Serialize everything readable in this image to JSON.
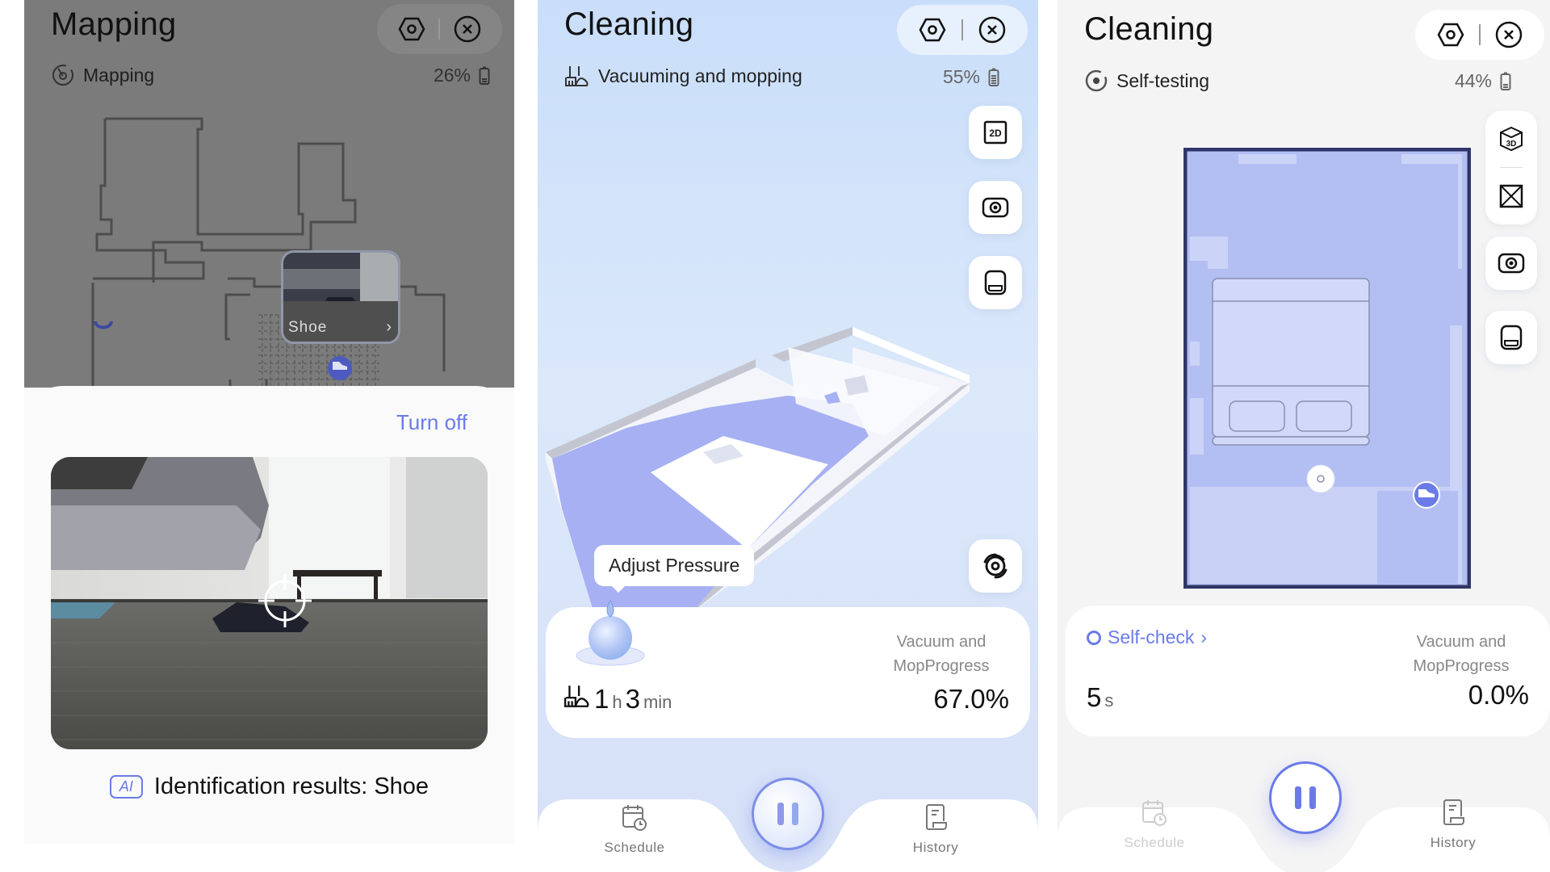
{
  "panels": [
    {
      "title": "Mapping",
      "status": {
        "icon": "mapping-icon",
        "text": "Mapping"
      },
      "battery": {
        "percent": "26%",
        "icon": "battery-icon"
      },
      "header_actions": [
        {
          "icon": "settings-hex-icon"
        },
        {
          "icon": "close-circle-icon"
        }
      ],
      "obstacle_thumbnail": {
        "label": "Shoe",
        "icon": "chevron-right-icon"
      },
      "map_markers": [
        {
          "icon": "shoe-marker-icon"
        },
        {
          "icon": "dock-icon"
        }
      ],
      "sheet": {
        "turn_off_label": "Turn off",
        "camera_view": {
          "description": "camera frame of shoe under sofa"
        },
        "ai_badge": "AI",
        "identification": "Identification results: Shoe"
      }
    },
    {
      "title": "Cleaning",
      "status": {
        "icon": "vacuum-mop-icon",
        "text": "Vacuuming and mopping"
      },
      "battery": {
        "percent": "55%",
        "icon": "battery-icon"
      },
      "header_actions": [
        {
          "icon": "settings-hex-icon"
        },
        {
          "icon": "close-circle-icon"
        }
      ],
      "side_buttons": [
        {
          "icon": "view-2d-icon",
          "label": "2D"
        },
        {
          "icon": "camera-icon"
        },
        {
          "icon": "dustbin-icon"
        },
        {
          "icon": "suction-fan-icon"
        }
      ],
      "tooltip": "Adjust Pressure",
      "card": {
        "duration": {
          "icon": "vacuum-mop-icon",
          "hours": "1",
          "hours_unit": "h",
          "minutes": "3",
          "minutes_unit": "min"
        },
        "progress_label": "Vacuum and MopProgress",
        "progress_value": "67.0%"
      },
      "tabbar": {
        "schedule_label": "Schedule",
        "history_label": "History",
        "pause_icon": "pause-icon"
      }
    },
    {
      "title": "Cleaning",
      "status": {
        "icon": "self-test-icon",
        "text": "Self-testing"
      },
      "battery": {
        "percent": "44%",
        "icon": "battery-icon"
      },
      "header_actions": [
        {
          "icon": "settings-hex-icon"
        },
        {
          "icon": "close-circle-icon"
        }
      ],
      "side_buttons": [
        {
          "icon": "view-3d-icon",
          "label": "3D"
        },
        {
          "icon": "no-go-zone-icon"
        },
        {
          "icon": "camera-icon"
        },
        {
          "icon": "dustbin-icon"
        }
      ],
      "card": {
        "selfcheck_label": "Self-check",
        "duration": {
          "seconds": "5",
          "seconds_unit": "s"
        },
        "progress_label": "Vacuum and MopProgress",
        "progress_value": "0.0%"
      },
      "tabbar": {
        "schedule_label": "Schedule",
        "history_label": "History",
        "pause_icon": "pause-icon"
      }
    }
  ],
  "colors": {
    "accent": "#6a7be8",
    "map_floor": "#b3bef2",
    "map_floor_light": "#cbd3f7",
    "map_wall": "#2f3566"
  }
}
